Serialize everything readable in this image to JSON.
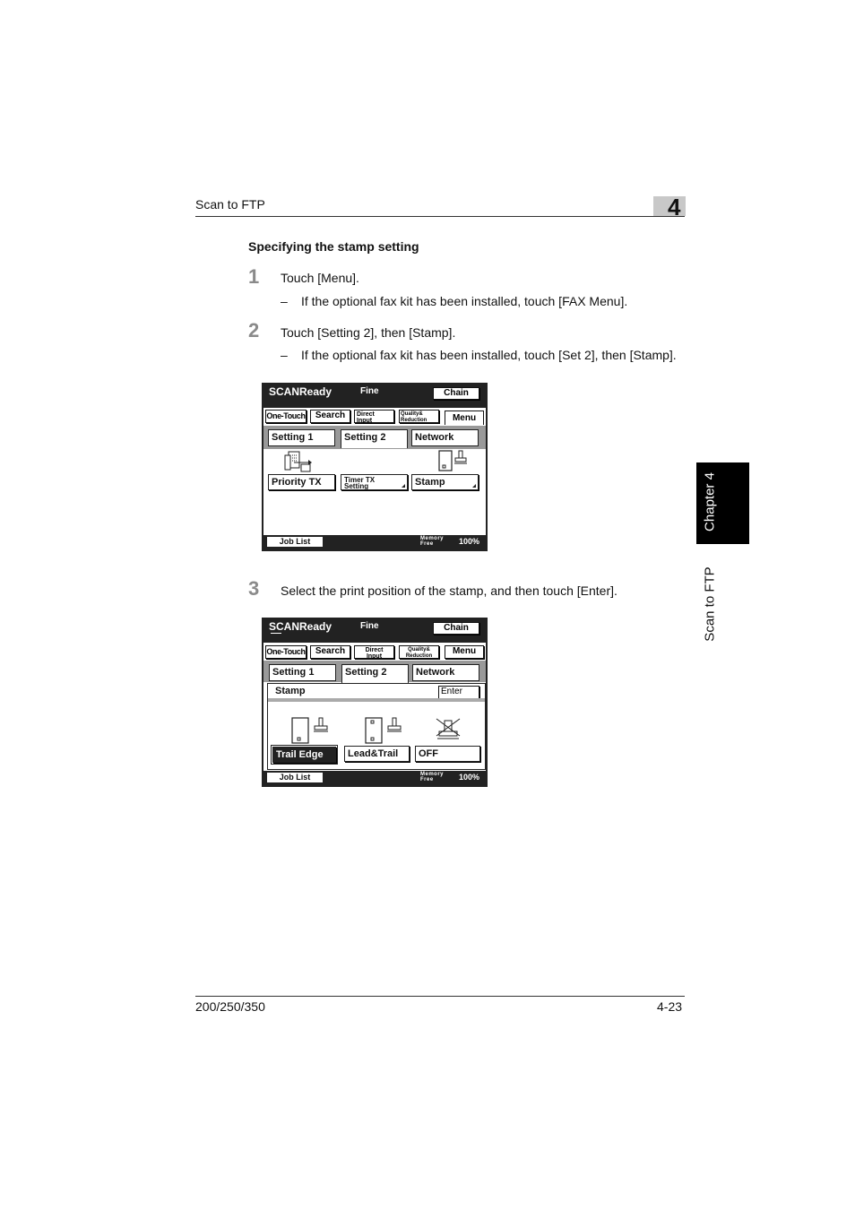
{
  "header": {
    "title": "Scan to FTP",
    "chapter_number": "4"
  },
  "side_tab": {
    "chapter": "Chapter 4",
    "section": "Scan to FTP"
  },
  "section_heading": "Specifying the stamp setting",
  "steps": [
    {
      "number": "1",
      "text": "Touch [Menu].",
      "sub_dash": "–",
      "sub": "If the optional fax kit has been installed, touch [FAX Menu]."
    },
    {
      "number": "2",
      "text": "Touch [Setting 2], then [Stamp].",
      "sub_dash": "–",
      "sub": "If the optional fax kit has been installed, touch [Set 2], then [Stamp]."
    },
    {
      "number": "3",
      "text": "Select the print position of the stamp, and then touch [Enter]."
    }
  ],
  "panel1": {
    "status": "SCANReady",
    "quality": "Fine",
    "chain": "Chain",
    "buttons": {
      "one_touch": "One-Touch",
      "search": "Search",
      "direct_input_1": "Direct",
      "direct_input_2": "Input",
      "quality_1": "Quality&",
      "quality_2": "Reduction",
      "menu": "Menu"
    },
    "tabs": [
      "Setting 1",
      "Setting 2",
      "Network"
    ],
    "options": {
      "priority": "Priority TX",
      "timer_1": "Timer TX",
      "timer_2": "Setting",
      "stamp": "Stamp"
    },
    "footer": {
      "job_list": "Job List",
      "memory": "Memory",
      "free": "Free",
      "percent": "100%"
    }
  },
  "panel2": {
    "status": "SCANReady",
    "quality": "Fine",
    "chain": "Chain",
    "buttons": {
      "one_touch": "One-Touch",
      "search": "Search",
      "direct_input_1": "Direct",
      "direct_input_2": "Input",
      "quality_1": "Quality&",
      "quality_2": "Reduction",
      "menu": "Menu"
    },
    "tabs": [
      "Setting 1",
      "Setting 2",
      "Network"
    ],
    "stamp_title": "Stamp",
    "enter": "Enter",
    "options": [
      "Trail Edge",
      "Lead&Trail",
      "OFF"
    ],
    "selected": "Trail Edge",
    "footer": {
      "job_list": "Job List",
      "memory": "Memory",
      "free": "Free",
      "percent": "100%"
    }
  },
  "footer": {
    "model": "200/250/350",
    "page": "4-23"
  }
}
